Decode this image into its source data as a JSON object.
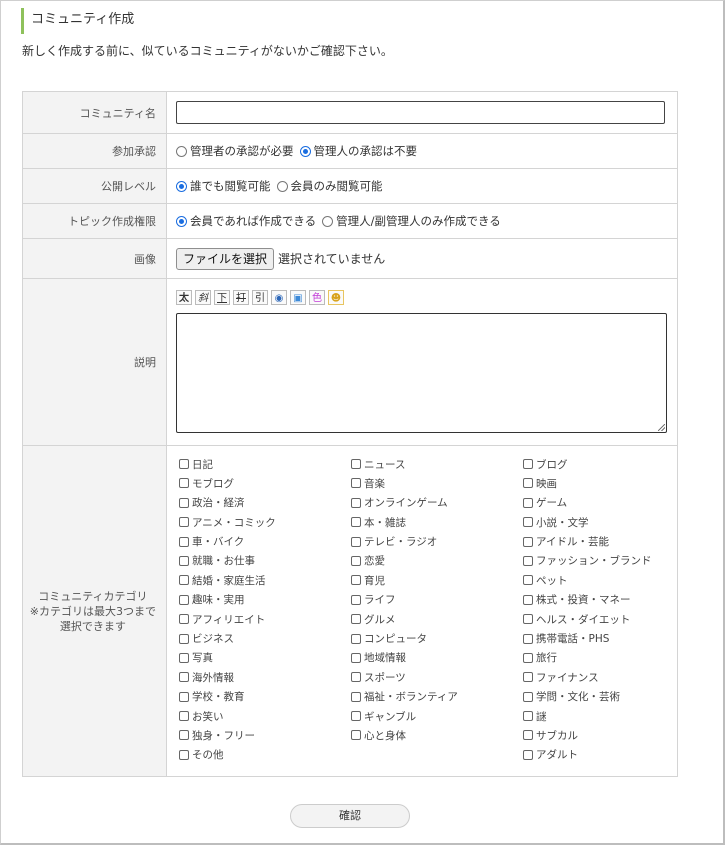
{
  "section_title": "コミュニティ作成",
  "intro": "新しく作成する前に、似ているコミュニティがないかご確認下さい。",
  "fields": {
    "name_label": "コミュニティ名",
    "join_label": "参加承認",
    "join_options": [
      "管理者の承認が必要",
      "管理人の承認は不要"
    ],
    "join_selected": 1,
    "public_label": "公開レベル",
    "public_options": [
      "誰でも閲覧可能",
      "会員のみ閲覧可能"
    ],
    "public_selected": 0,
    "topic_label": "トピック作成権限",
    "topic_options": [
      "会員であれば作成できる",
      "管理人/副管理人のみ作成できる"
    ],
    "topic_selected": 0,
    "image_label": "画像",
    "file_button": "ファイルを選択",
    "file_status": "選択されていません",
    "desc_label": "説明",
    "toolbar": [
      "太",
      "斜",
      "下",
      "打",
      "引",
      "link-icon",
      "image-icon",
      "color-icon",
      "emoji-icon"
    ],
    "category_label_line1": "コミュニティカテゴリ",
    "category_label_line2": "※カテゴリは最大3つまで",
    "category_label_line3": "選択できます"
  },
  "categories": [
    "日記",
    "ニュース",
    "ブログ",
    "モブログ",
    "音楽",
    "映画",
    "政治・経済",
    "オンラインゲーム",
    "ゲーム",
    "アニメ・コミック",
    "本・雑誌",
    "小説・文学",
    "車・バイク",
    "テレビ・ラジオ",
    "アイドル・芸能",
    "就職・お仕事",
    "恋愛",
    "ファッション・ブランド",
    "結婚・家庭生活",
    "育児",
    "ペット",
    "趣味・実用",
    "ライフ",
    "株式・投資・マネー",
    "アフィリエイト",
    "グルメ",
    "ヘルス・ダイエット",
    "ビジネス",
    "コンピュータ",
    "携帯電話・PHS",
    "写真",
    "地域情報",
    "旅行",
    "海外情報",
    "スポーツ",
    "ファイナンス",
    "学校・教育",
    "福祉・ボランティア",
    "学問・文化・芸術",
    "お笑い",
    "ギャンブル",
    "謎",
    "独身・フリー",
    "心と身体",
    "サブカル",
    "その他",
    "",
    "アダルト"
  ],
  "confirm_button": "確認"
}
